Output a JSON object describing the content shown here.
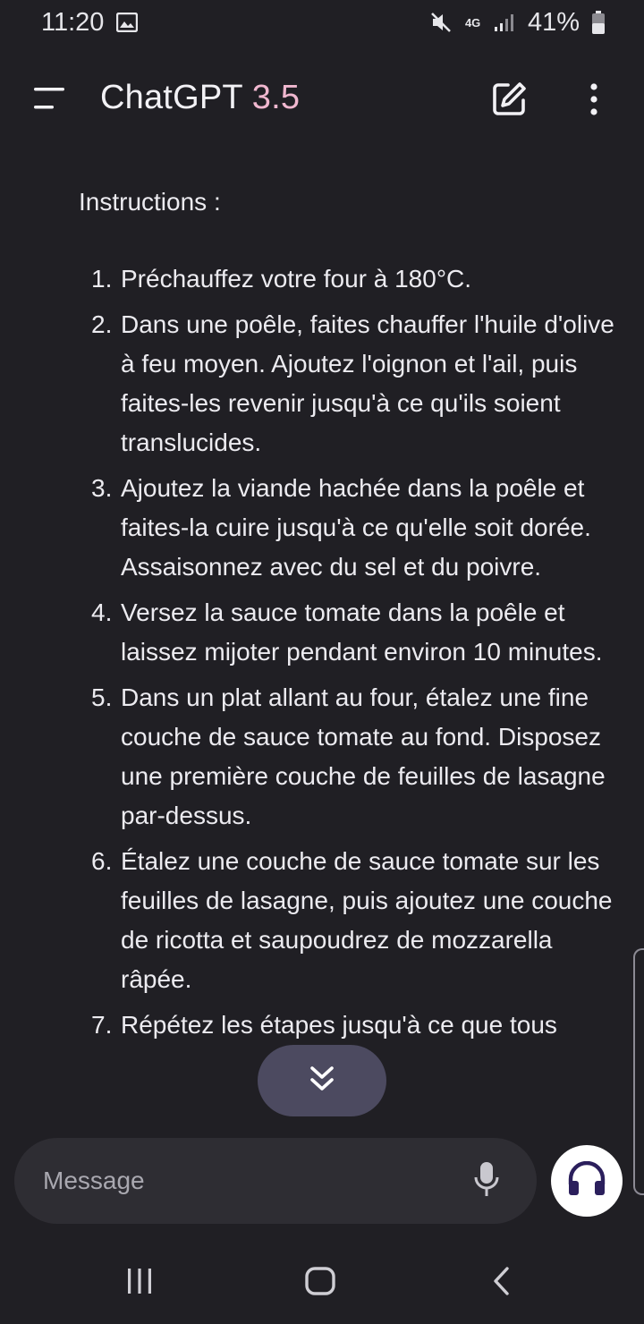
{
  "status_bar": {
    "time": "11:20",
    "network": "4G",
    "battery": "41%",
    "icons": [
      "image-icon",
      "mute-icon",
      "signal-icon",
      "battery-icon"
    ]
  },
  "header": {
    "title": "ChatGPT",
    "version": "3.5",
    "version_color": "#f0b7cf",
    "icons": [
      "menu-icon",
      "new-chat-icon",
      "more-vertical-icon"
    ]
  },
  "message": {
    "intro": "Instructions :",
    "steps": [
      {
        "num": "1.",
        "text": "Préchauffez votre four à 180°C."
      },
      {
        "num": "2.",
        "text": "Dans une poêle, faites chauffer l'huile d'olive à feu moyen. Ajoutez l'oignon et l'ail, puis faites-les revenir jusqu'à ce qu'ils soient translucides."
      },
      {
        "num": "3.",
        "text": "Ajoutez la viande hachée dans la poêle et faites-la cuire jusqu'à ce qu'elle soit dorée. Assaisonnez avec du sel et du poivre."
      },
      {
        "num": "4.",
        "text": "Versez la sauce tomate dans la poêle et laissez mijoter pendant environ 10 minutes."
      },
      {
        "num": "5.",
        "text": "Dans un plat allant au four, étalez une fine couche de sauce tomate au fond. Disposez une première couche de feuilles de lasagne par-dessus."
      },
      {
        "num": "6.",
        "text": "Étalez une couche de sauce tomate sur les feuilles de lasagne, puis ajoutez une couche de ricotta et saupoudrez de mozzarella râpée."
      },
      {
        "num": "7.",
        "text": "Répétez les étapes jusqu'à ce que tous"
      }
    ]
  },
  "composer": {
    "placeholder": "Message",
    "icons": [
      "microphone-icon",
      "headphones-icon"
    ]
  },
  "nav_bar": {
    "icons": [
      "recent-apps-icon",
      "home-icon",
      "back-icon"
    ]
  },
  "colors": {
    "background": "#201f24",
    "composer": "#2e2d33",
    "scroll_pill": "#4c4a60",
    "voice_icon": "#2b1f5c"
  }
}
